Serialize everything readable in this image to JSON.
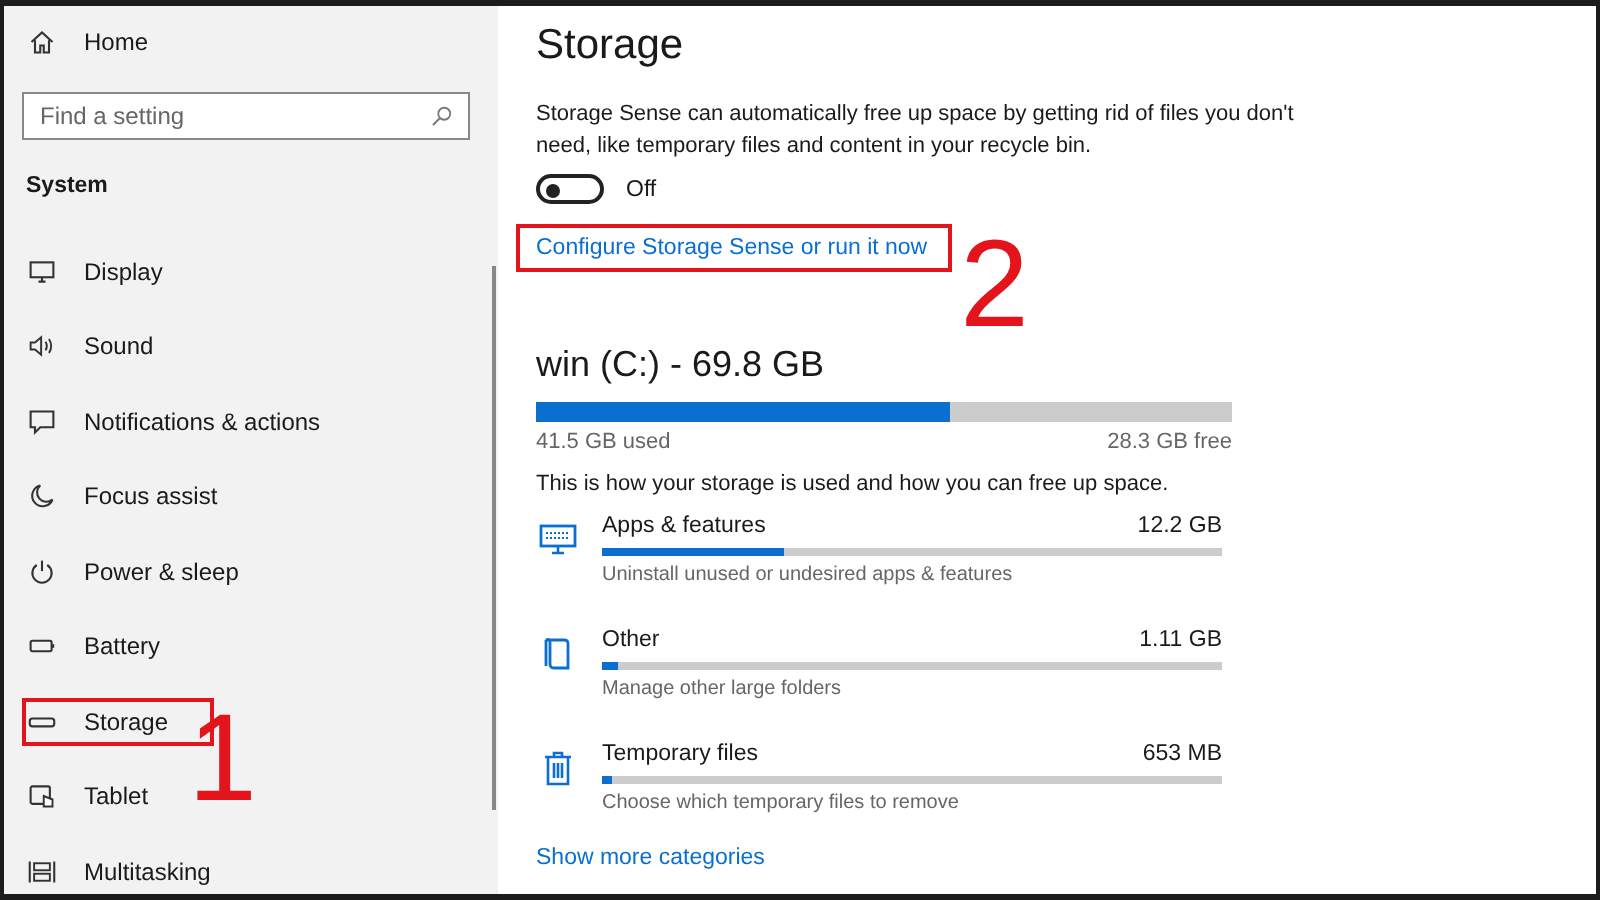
{
  "sidebar": {
    "home": "Home",
    "search": {
      "placeholder": "Find a setting"
    },
    "section": "System",
    "items": [
      {
        "label": "Display",
        "kind": "display",
        "highlighted": false
      },
      {
        "label": "Sound",
        "kind": "sound",
        "highlighted": false
      },
      {
        "label": "Notifications & actions",
        "kind": "notifications",
        "highlighted": false
      },
      {
        "label": "Focus assist",
        "kind": "focus",
        "highlighted": false
      },
      {
        "label": "Power & sleep",
        "kind": "power",
        "highlighted": false
      },
      {
        "label": "Battery",
        "kind": "battery",
        "highlighted": false
      },
      {
        "label": "Storage",
        "kind": "storage",
        "highlighted": true
      },
      {
        "label": "Tablet",
        "kind": "tablet",
        "highlighted": false
      },
      {
        "label": "Multitasking",
        "kind": "multitasking",
        "highlighted": false
      }
    ]
  },
  "page": {
    "title": "Storage",
    "description": "Storage Sense can automatically free up space by getting rid of files you don't need, like temporary files and content in your recycle bin.",
    "toggle": {
      "on": false,
      "label": "Off"
    },
    "link": {
      "label": "Configure Storage Sense or run it now",
      "highlighted": true
    },
    "drive": {
      "title": "win (C:) - 69.8 GB",
      "level": 0.595,
      "used": "41.5 GB used",
      "free": "28.3 GB free"
    },
    "info": "This is how your storage is used and how you can free up space.",
    "categories": [
      {
        "kind": "apps",
        "name": "Apps & features",
        "size": "12.2 GB",
        "level": 0.295,
        "description": "Uninstall unused or undesired apps & features"
      },
      {
        "kind": "other",
        "name": "Other",
        "size": "1.11 GB",
        "level": 0.027,
        "description": "Manage other large folders"
      },
      {
        "kind": "temp",
        "name": "Temporary files",
        "size": "653 MB",
        "level": 0.016,
        "description": "Choose which temporary files to remove"
      }
    ],
    "more_link": "Show more categories"
  },
  "annotations": [
    {
      "label": "1"
    },
    {
      "label": "2"
    }
  ]
}
